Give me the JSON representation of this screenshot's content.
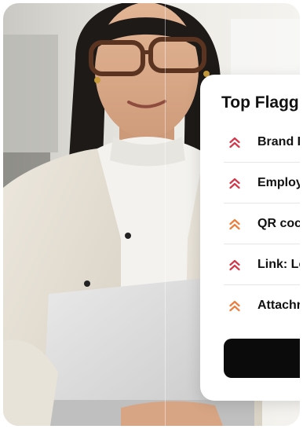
{
  "card": {
    "title": "Top Flagg",
    "button_label": "",
    "items": [
      {
        "label": "Brand I",
        "severity": "high",
        "icon": "double-chevron-up-icon",
        "color": "#d6364a"
      },
      {
        "label": "Employ",
        "severity": "high",
        "icon": "double-chevron-up-icon",
        "color": "#d6364a"
      },
      {
        "label": "QR coc",
        "severity": "medium",
        "icon": "double-chevron-up-icon",
        "color": "#ee7d3c"
      },
      {
        "label": "Link: Le",
        "severity": "high",
        "icon": "double-chevron-up-icon",
        "color": "#d6364a"
      },
      {
        "label": "Attachr",
        "severity": "medium",
        "icon": "double-chevron-up-icon",
        "color": "#ee7d3c"
      }
    ]
  },
  "colors": {
    "high": "#d6364a",
    "medium": "#ee7d3c",
    "button": "#0b0b0b"
  }
}
